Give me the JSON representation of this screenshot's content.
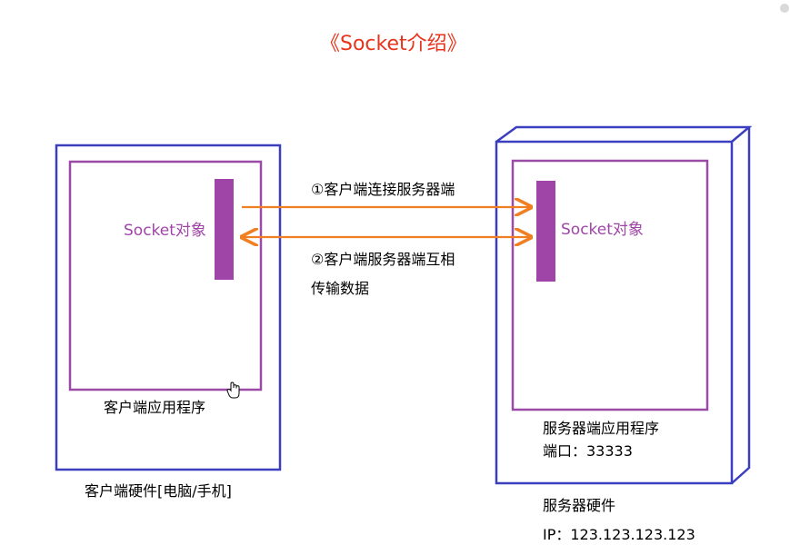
{
  "title": "《Socket介绍》",
  "client": {
    "socket_label": "Socket对象",
    "app_label": "客户端应用程序",
    "hardware_label": "客户端硬件[电脑/手机]"
  },
  "server": {
    "socket_label": "Socket对象",
    "app_label": "服务器端应用程序",
    "port_label": "端口：33333",
    "hardware_label": "服务器硬件",
    "ip_label": "IP：123.123.123.123"
  },
  "arrows": {
    "connect_label": "①客户端连接服务器端",
    "transfer_label_line1": "②客户端服务器端互相",
    "transfer_label_line2": "传输数据"
  },
  "colors": {
    "hardware_border": "#3b3fbf",
    "app_border": "#9b4aa6",
    "socket_fill": "#a045a8",
    "arrow": "#f07f22",
    "title": "#e8341c"
  },
  "icons": {
    "cursor": "hand-pointer-icon"
  }
}
